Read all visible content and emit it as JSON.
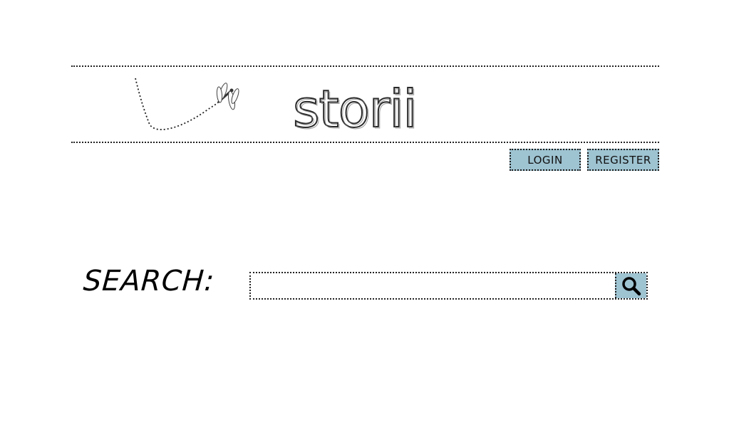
{
  "header": {
    "logo_text": "storii",
    "logo_icon": "dragonfly-icon"
  },
  "auth": {
    "login_label": "LOGIN",
    "register_label": "REGISTER",
    "button_color": "#9ec3d1"
  },
  "search": {
    "label": "SEARCH:",
    "value": "",
    "placeholder": "",
    "button_icon": "magnifier-icon"
  }
}
